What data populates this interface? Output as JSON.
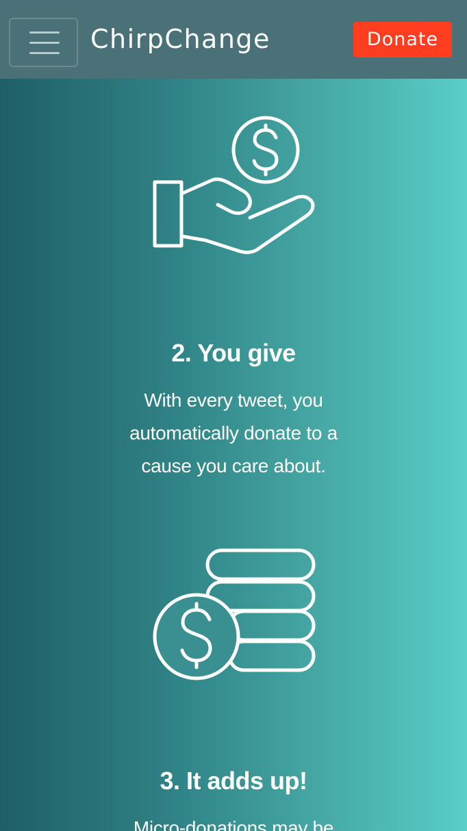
{
  "navbar": {
    "menu_icon": "hamburger-icon",
    "brand": "ChirpChange",
    "donate_label": "Donate",
    "donate_color": "#ff3d1f",
    "background_color": "#4a7178"
  },
  "steps": [
    {
      "icon": "hand-coin-icon",
      "title": "2. You give",
      "text": "With every tweet, you automatically donate to a cause you care about."
    },
    {
      "icon": "coin-stack-icon",
      "title": "3. It adds up!",
      "text": "Micro-donations may be"
    }
  ],
  "theme": {
    "gradient_start": "#1f5f68",
    "gradient_end": "#58cfc6",
    "text_color": "#ffffff"
  }
}
